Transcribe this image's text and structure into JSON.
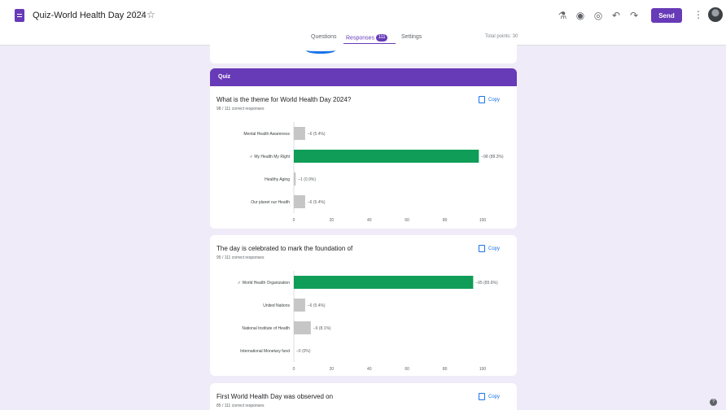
{
  "header": {
    "title": "Quiz-World Health Day 2024",
    "send_label": "Send"
  },
  "tabs": {
    "questions": "Questions",
    "responses": "Responses",
    "responses_count": "111",
    "settings": "Settings",
    "total_points": "Total points: 30"
  },
  "section": {
    "title": "Quiz"
  },
  "questions": [
    {
      "title": "What is the theme for World Health Day 2024?",
      "subtitle": "98 / 111 correct responses",
      "copy_label": "Copy"
    },
    {
      "title": "The day is celebrated to mark the foundation of",
      "subtitle": "95 / 111 correct responses",
      "copy_label": "Copy"
    },
    {
      "title": "First World Health Day was observed on",
      "subtitle": "85 / 111 correct responses",
      "copy_label": "Copy"
    }
  ],
  "colors": {
    "accent": "#673ab7",
    "correct": "#0f9d58",
    "other": "#c6c6c6",
    "link": "#1a73e8"
  },
  "chart_data": [
    {
      "type": "bar",
      "orientation": "horizontal",
      "categories": [
        "Mental Health Awareness",
        "My Health My Right",
        "Healthy Aging",
        "Our planet our Health"
      ],
      "values": [
        6,
        98,
        1,
        6
      ],
      "data_labels": [
        "6 (5.4%)",
        "98 (88.3%)",
        "1 (0.9%)",
        "6 (5.4%)"
      ],
      "correct": [
        false,
        true,
        false,
        false
      ],
      "xlim": [
        0,
        100
      ],
      "xticks": [
        "0",
        "20",
        "40",
        "60",
        "80",
        "100"
      ]
    },
    {
      "type": "bar",
      "orientation": "horizontal",
      "categories": [
        "World Health Organization",
        "United Nations",
        "National Institute of Health",
        "International Monetary fund"
      ],
      "values": [
        95,
        6,
        9,
        0
      ],
      "data_labels": [
        "95 (85.6%)",
        "6 (5.4%)",
        "9 (8.1%)",
        "0 (0%)"
      ],
      "correct": [
        true,
        false,
        false,
        false
      ],
      "xlim": [
        0,
        100
      ],
      "xticks": [
        "0",
        "20",
        "40",
        "60",
        "80",
        "100"
      ]
    }
  ]
}
